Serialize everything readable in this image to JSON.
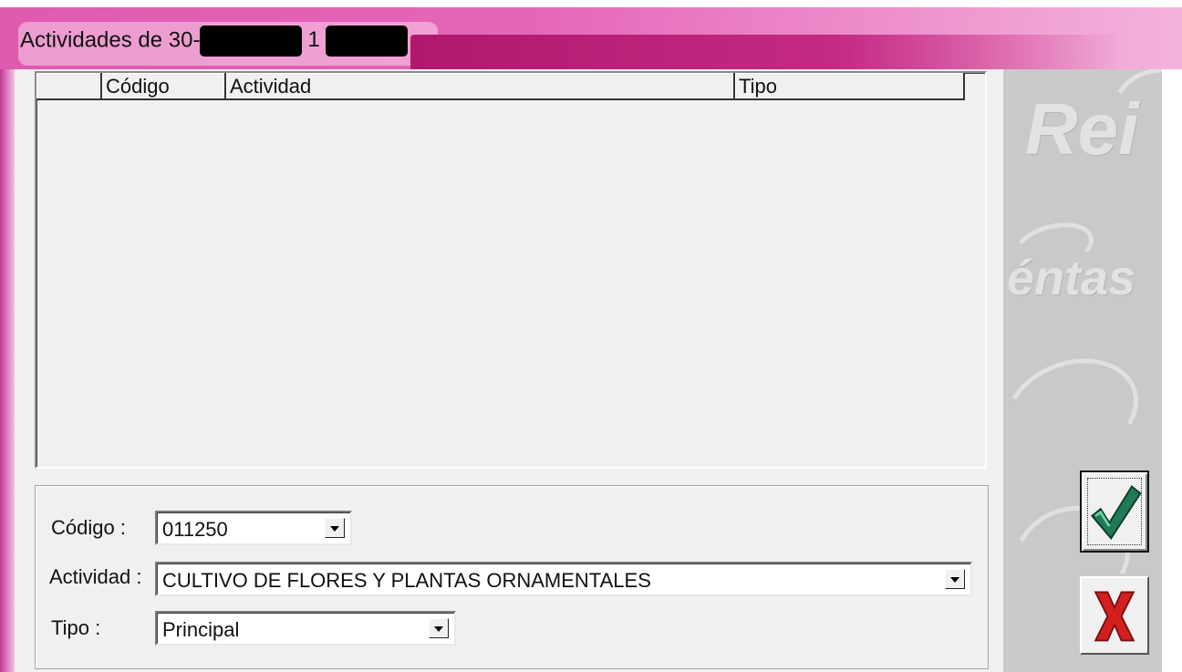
{
  "window": {
    "title": "Actividades de 30-",
    "title_mid": "1"
  },
  "table": {
    "columns": [
      "",
      "Código",
      "Actividad",
      "Tipo"
    ]
  },
  "form": {
    "codigo_label": "Código :",
    "codigo_value": "011250",
    "actividad_label": "Actividad :",
    "actividad_value": "CULTIVO DE FLORES Y PLANTAS ORNAMENTALES",
    "tipo_label": "Tipo :",
    "tipo_value": "Principal"
  },
  "watermark": {
    "line1": "Rei",
    "line2": "éntas"
  },
  "buttons": {
    "ok_icon": "checkmark-icon",
    "cancel_icon": "x-icon"
  },
  "colors": {
    "title_bar": "#e566b8",
    "ok_check": "#1f7a55",
    "cancel_x": "#d41f1f"
  }
}
